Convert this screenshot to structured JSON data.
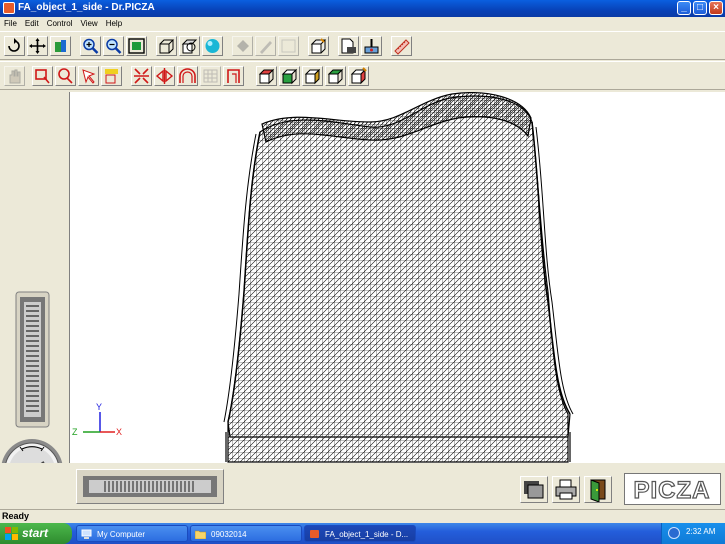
{
  "window": {
    "title": "FA_object_1_side - Dr.PICZA",
    "minimize": "_",
    "maximize": "□",
    "close": "×"
  },
  "menu": [
    "File",
    "Edit",
    "Control",
    "View",
    "Help"
  ],
  "toolbar_row1": [
    "rotate-tool-icon",
    "move-tool-icon",
    "color-tool-icon",
    "zoom-in-icon",
    "zoom-out-icon",
    "fit-view-icon",
    "wireframe-cube-icon",
    "shaded-cube-icon",
    "sphere-icon",
    "paint-bucket-icon",
    "brush-icon",
    "blank-tool-icon",
    "edit-mesh-icon",
    "scan-document-icon",
    "scan-settings-icon",
    "measure-icon"
  ],
  "toolbar_row2": [
    "hand-icon",
    "select-rect-icon",
    "select-lasso-icon",
    "select-point-icon",
    "select-all-icon",
    "align-icon",
    "mirror-icon",
    "smooth-icon",
    "grid-icon",
    "crop-icon",
    "layer-1-icon",
    "layer-2-icon",
    "layer-3-icon",
    "layer-4-icon",
    "layer-5-icon"
  ],
  "axes": {
    "y": "Y",
    "z": "Z",
    "x": "X"
  },
  "bottom_buttons": [
    "view-reset-icon",
    "print-icon",
    "exit-door-icon"
  ],
  "logo": "PICZA",
  "status": "Ready",
  "taskbar": {
    "start": "start",
    "tasks": [
      "My Computer",
      "09032014",
      "FA_object_1_side - D..."
    ],
    "clock": "2:32 AM"
  },
  "colors": {
    "titlebar": "#0842b8",
    "taskbar": "#245edb",
    "start": "#2e8b2e",
    "axis_x": "#e02020",
    "axis_y": "#2020e0",
    "axis_z": "#20a020"
  }
}
